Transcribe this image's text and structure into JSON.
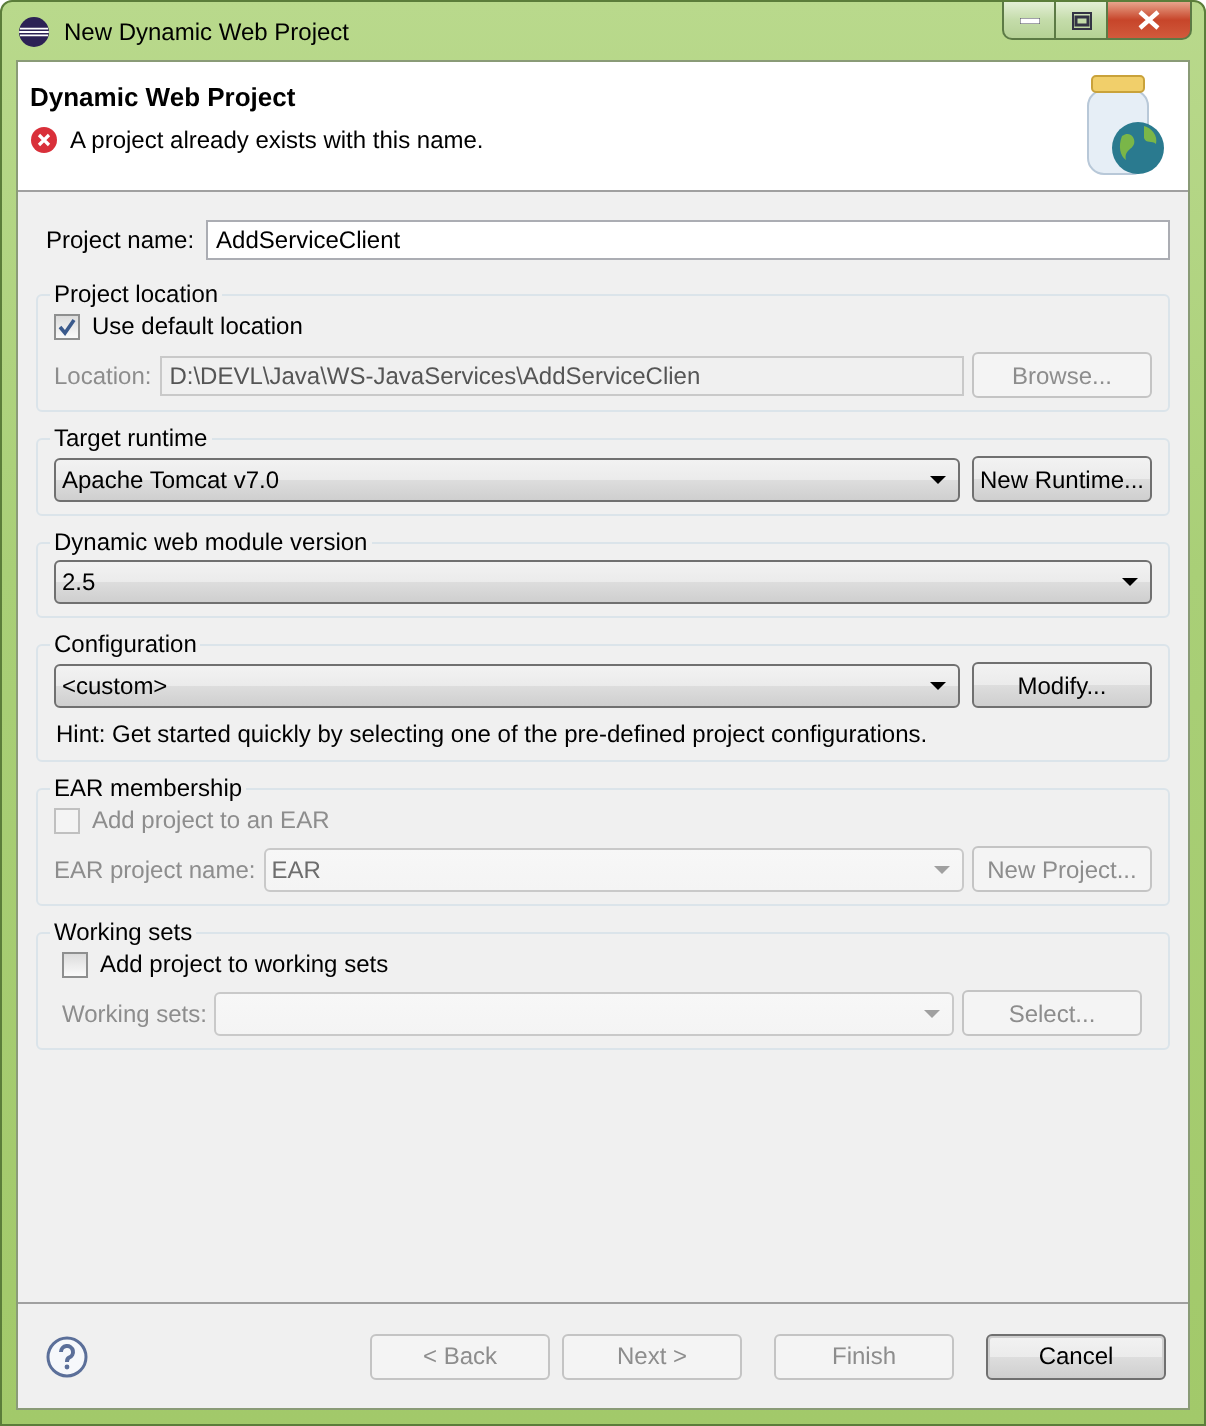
{
  "window": {
    "title": "New Dynamic Web Project"
  },
  "header": {
    "title": "Dynamic Web Project",
    "error": "A project already exists with this name."
  },
  "project_name": {
    "label": "Project name:",
    "value": "AddServiceClient"
  },
  "project_location": {
    "title": "Project location",
    "use_default": {
      "label": "Use default location",
      "checked": true,
      "disabled": false
    },
    "location": {
      "label": "Location:",
      "value": "D:\\DEVL\\Java\\WS-JavaServices\\AddServiceClien",
      "disabled": true
    },
    "button": {
      "label": "Browse...",
      "disabled": true
    }
  },
  "target_runtime": {
    "title": "Target runtime",
    "value": "Apache Tomcat v7.0",
    "button": {
      "label": "New Runtime...",
      "disabled": false
    }
  },
  "module_version": {
    "title": "Dynamic web module version",
    "value": "2.5"
  },
  "configuration": {
    "title": "Configuration",
    "value": "<custom>",
    "button": {
      "label": "Modify...",
      "disabled": false
    },
    "hint": "Hint: Get started quickly by selecting one of the pre-defined project configurations."
  },
  "ear_membership": {
    "title": "EAR membership",
    "add": {
      "label": "Add project to an EAR",
      "checked": false,
      "disabled": true
    },
    "project_name": {
      "label": "EAR project name:",
      "value": "EAR",
      "disabled": true
    },
    "button": {
      "label": "New Project...",
      "disabled": true
    }
  },
  "working_sets": {
    "title": "Working sets",
    "add": {
      "label": "Add project to working sets",
      "checked": false,
      "disabled": false
    },
    "sets": {
      "label": "Working sets:",
      "disabled": true
    },
    "button": {
      "label": "Select...",
      "disabled": true
    }
  },
  "buttons": [
    {
      "label": "< Back",
      "disabled": true,
      "default": false
    },
    {
      "label": "Next >",
      "disabled": true,
      "default": false
    },
    {
      "label": "Finish",
      "disabled": true,
      "default": false
    },
    {
      "label": "Cancel",
      "disabled": false,
      "default": true
    }
  ]
}
